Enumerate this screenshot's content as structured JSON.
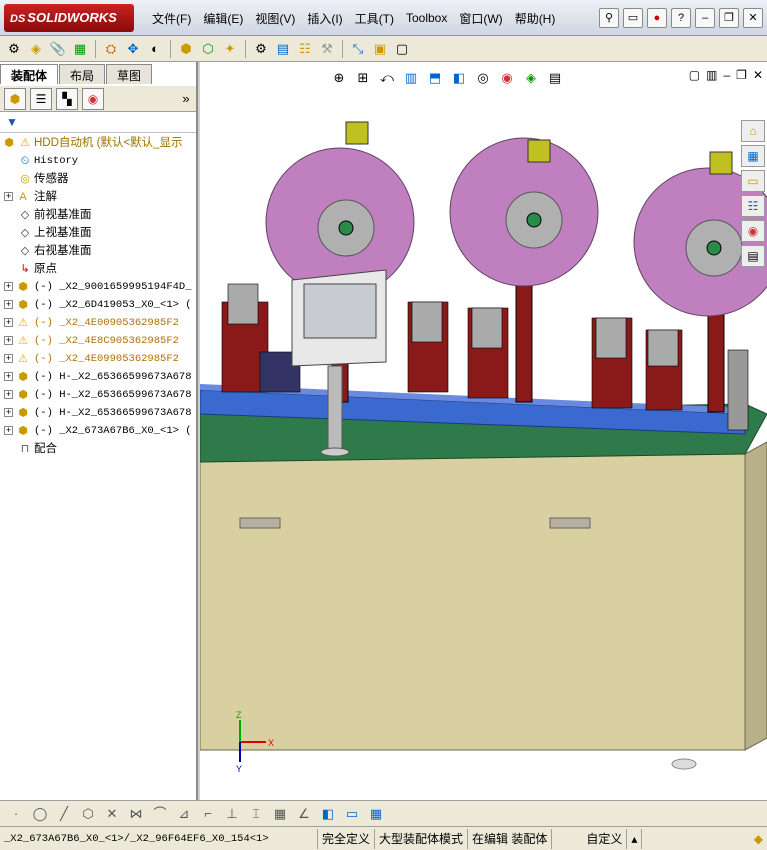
{
  "app": {
    "logo_ds": "DS",
    "logo_text": "SOLIDWORKS"
  },
  "menu": [
    "文件(F)",
    "编辑(E)",
    "视图(V)",
    "插入(I)",
    "工具(T)",
    "Toolbox",
    "窗口(W)",
    "帮助(H)"
  ],
  "panel_tabs": [
    "装配体",
    "布局",
    "草图"
  ],
  "tree": {
    "root": "HDD自动机  (默认<默认_显示",
    "items": [
      {
        "label": "History",
        "icon": "history-icon",
        "expand": false,
        "mono": true,
        "warn": false
      },
      {
        "label": "传感器",
        "icon": "sensor-icon",
        "expand": false,
        "mono": false,
        "warn": false
      },
      {
        "label": "注解",
        "icon": "annotation-icon",
        "expand": true,
        "mono": false,
        "warn": false
      },
      {
        "label": "前视基准面",
        "icon": "plane-icon",
        "expand": false,
        "mono": false,
        "warn": false
      },
      {
        "label": "上视基准面",
        "icon": "plane-icon",
        "expand": false,
        "mono": false,
        "warn": false
      },
      {
        "label": "右视基准面",
        "icon": "plane-icon",
        "expand": false,
        "mono": false,
        "warn": false
      },
      {
        "label": "原点",
        "icon": "origin-icon",
        "expand": false,
        "mono": false,
        "warn": false
      },
      {
        "label": "(-) _X2_9001659995194F4D_",
        "icon": "part-icon",
        "expand": true,
        "mono": true,
        "warn": false
      },
      {
        "label": "(-) _X2_6D419053_X0_<1> (",
        "icon": "part-icon",
        "expand": true,
        "mono": true,
        "warn": false
      },
      {
        "label": "(-) _X2_4E00905362985F2",
        "icon": "warning-icon",
        "expand": true,
        "mono": true,
        "warn": true
      },
      {
        "label": "(-) _X2_4E8C905362985F2",
        "icon": "warning-icon",
        "expand": true,
        "mono": true,
        "warn": true
      },
      {
        "label": "(-) _X2_4E09905362985F2",
        "icon": "warning-icon",
        "expand": true,
        "mono": true,
        "warn": true
      },
      {
        "label": "(-) H-_X2_65366599673A678",
        "icon": "part-icon",
        "expand": true,
        "mono": true,
        "warn": false
      },
      {
        "label": "(-) H-_X2_65366599673A678",
        "icon": "part-icon",
        "expand": true,
        "mono": true,
        "warn": false
      },
      {
        "label": "(-) H-_X2_65366599673A678",
        "icon": "part-icon",
        "expand": true,
        "mono": true,
        "warn": false
      },
      {
        "label": "(-) _X2_673A67B6_X0_<1> (",
        "icon": "part-icon",
        "expand": true,
        "mono": true,
        "warn": false
      },
      {
        "label": "配合",
        "icon": "mates-icon",
        "expand": false,
        "mono": false,
        "warn": false
      }
    ]
  },
  "triad": {
    "x": "X",
    "y": "Y",
    "z": "Z"
  },
  "status": {
    "path": "_X2_673A67B6_X0_<1>/_X2_96F64EF6_X0_154<1>",
    "defined": "完全定义",
    "mode": "大型装配体模式",
    "editing": "在编辑 装配体",
    "custom": "自定义"
  },
  "colors": {
    "accent": "#cc2222",
    "reel": "#c080c0",
    "base": "#d8d0a0",
    "plate": "#2e7a4a",
    "rail": "#3a6ad0"
  }
}
